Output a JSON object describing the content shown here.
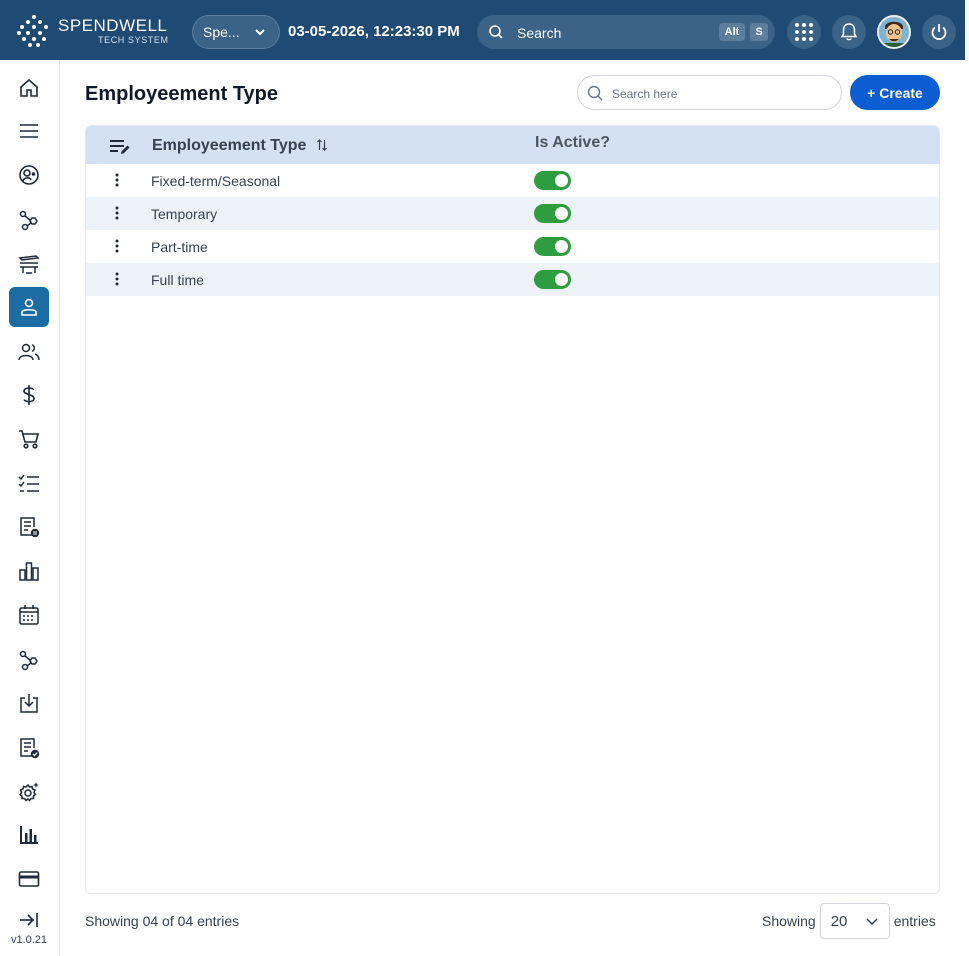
{
  "header": {
    "logo_name": "SPENDWELL",
    "logo_tagline": "TECH SYSTEM",
    "org_select": "Spe...",
    "datetime": "03-05-2026, 12:23:30 PM",
    "search_placeholder": "Search",
    "shortcut_key1": "Alt",
    "shortcut_key2": "S",
    "colors": {
      "bar": "#1e4a73",
      "pill": "#3b6287"
    }
  },
  "sidebar": {
    "items": [
      {
        "icon": "home-icon"
      },
      {
        "icon": "menu-icon"
      },
      {
        "icon": "user-circle-icon"
      },
      {
        "icon": "workflow-icon"
      },
      {
        "icon": "desk-icon"
      },
      {
        "icon": "person-icon",
        "active": true
      },
      {
        "icon": "people-icon"
      },
      {
        "icon": "dollar-icon"
      },
      {
        "icon": "cart-icon"
      },
      {
        "icon": "checklist-icon"
      },
      {
        "icon": "document-badge-icon"
      },
      {
        "icon": "bar-chart-icon"
      },
      {
        "icon": "calendar-icon"
      },
      {
        "icon": "workflow-icon"
      },
      {
        "icon": "download-tray-icon"
      },
      {
        "icon": "document-check-icon"
      },
      {
        "icon": "settings-sparkle-icon"
      },
      {
        "icon": "analytics-icon"
      },
      {
        "icon": "credit-card-icon"
      },
      {
        "icon": "collapse-arrow-icon"
      }
    ],
    "version": "v1.0.21",
    "active_color": "#1a6ca3"
  },
  "main": {
    "title": "Employeement Type",
    "search_placeholder": "Search here",
    "create_label": "+ Create",
    "table": {
      "columns": [
        "Employeement Type",
        "Is Active?"
      ],
      "rows": [
        {
          "name": "Fixed-term/Seasonal",
          "active": true
        },
        {
          "name": "Temporary",
          "active": true
        },
        {
          "name": "Part-time",
          "active": true
        },
        {
          "name": "Full time",
          "active": true
        }
      ]
    },
    "footer": {
      "entries_text": "Showing 04 of 04 entries",
      "showing_label": "Showing",
      "page_size": "20",
      "entries_label": "entries"
    }
  }
}
